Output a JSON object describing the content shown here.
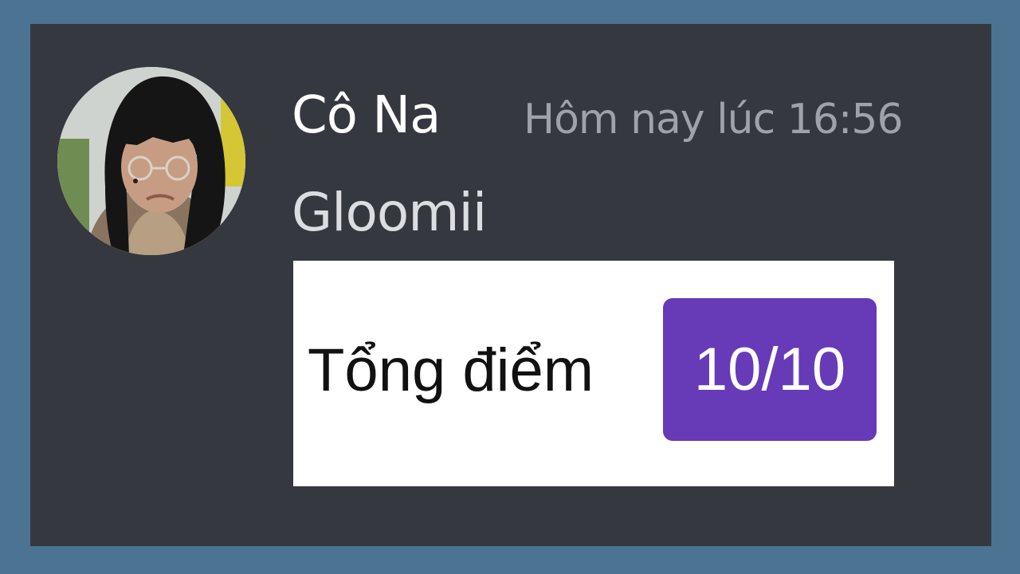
{
  "message": {
    "author": "Cô Na",
    "timestamp": "Hôm nay lúc 16:56",
    "text": "Gloomii"
  },
  "attachment": {
    "label": "Tổng điểm",
    "score": "10/10"
  },
  "colors": {
    "border": "#4a7491",
    "panel": "#363840",
    "author": "#ffffff",
    "timestamp": "#9fa3a8",
    "message_text": "#dcdde0",
    "badge": "#673ab7"
  }
}
